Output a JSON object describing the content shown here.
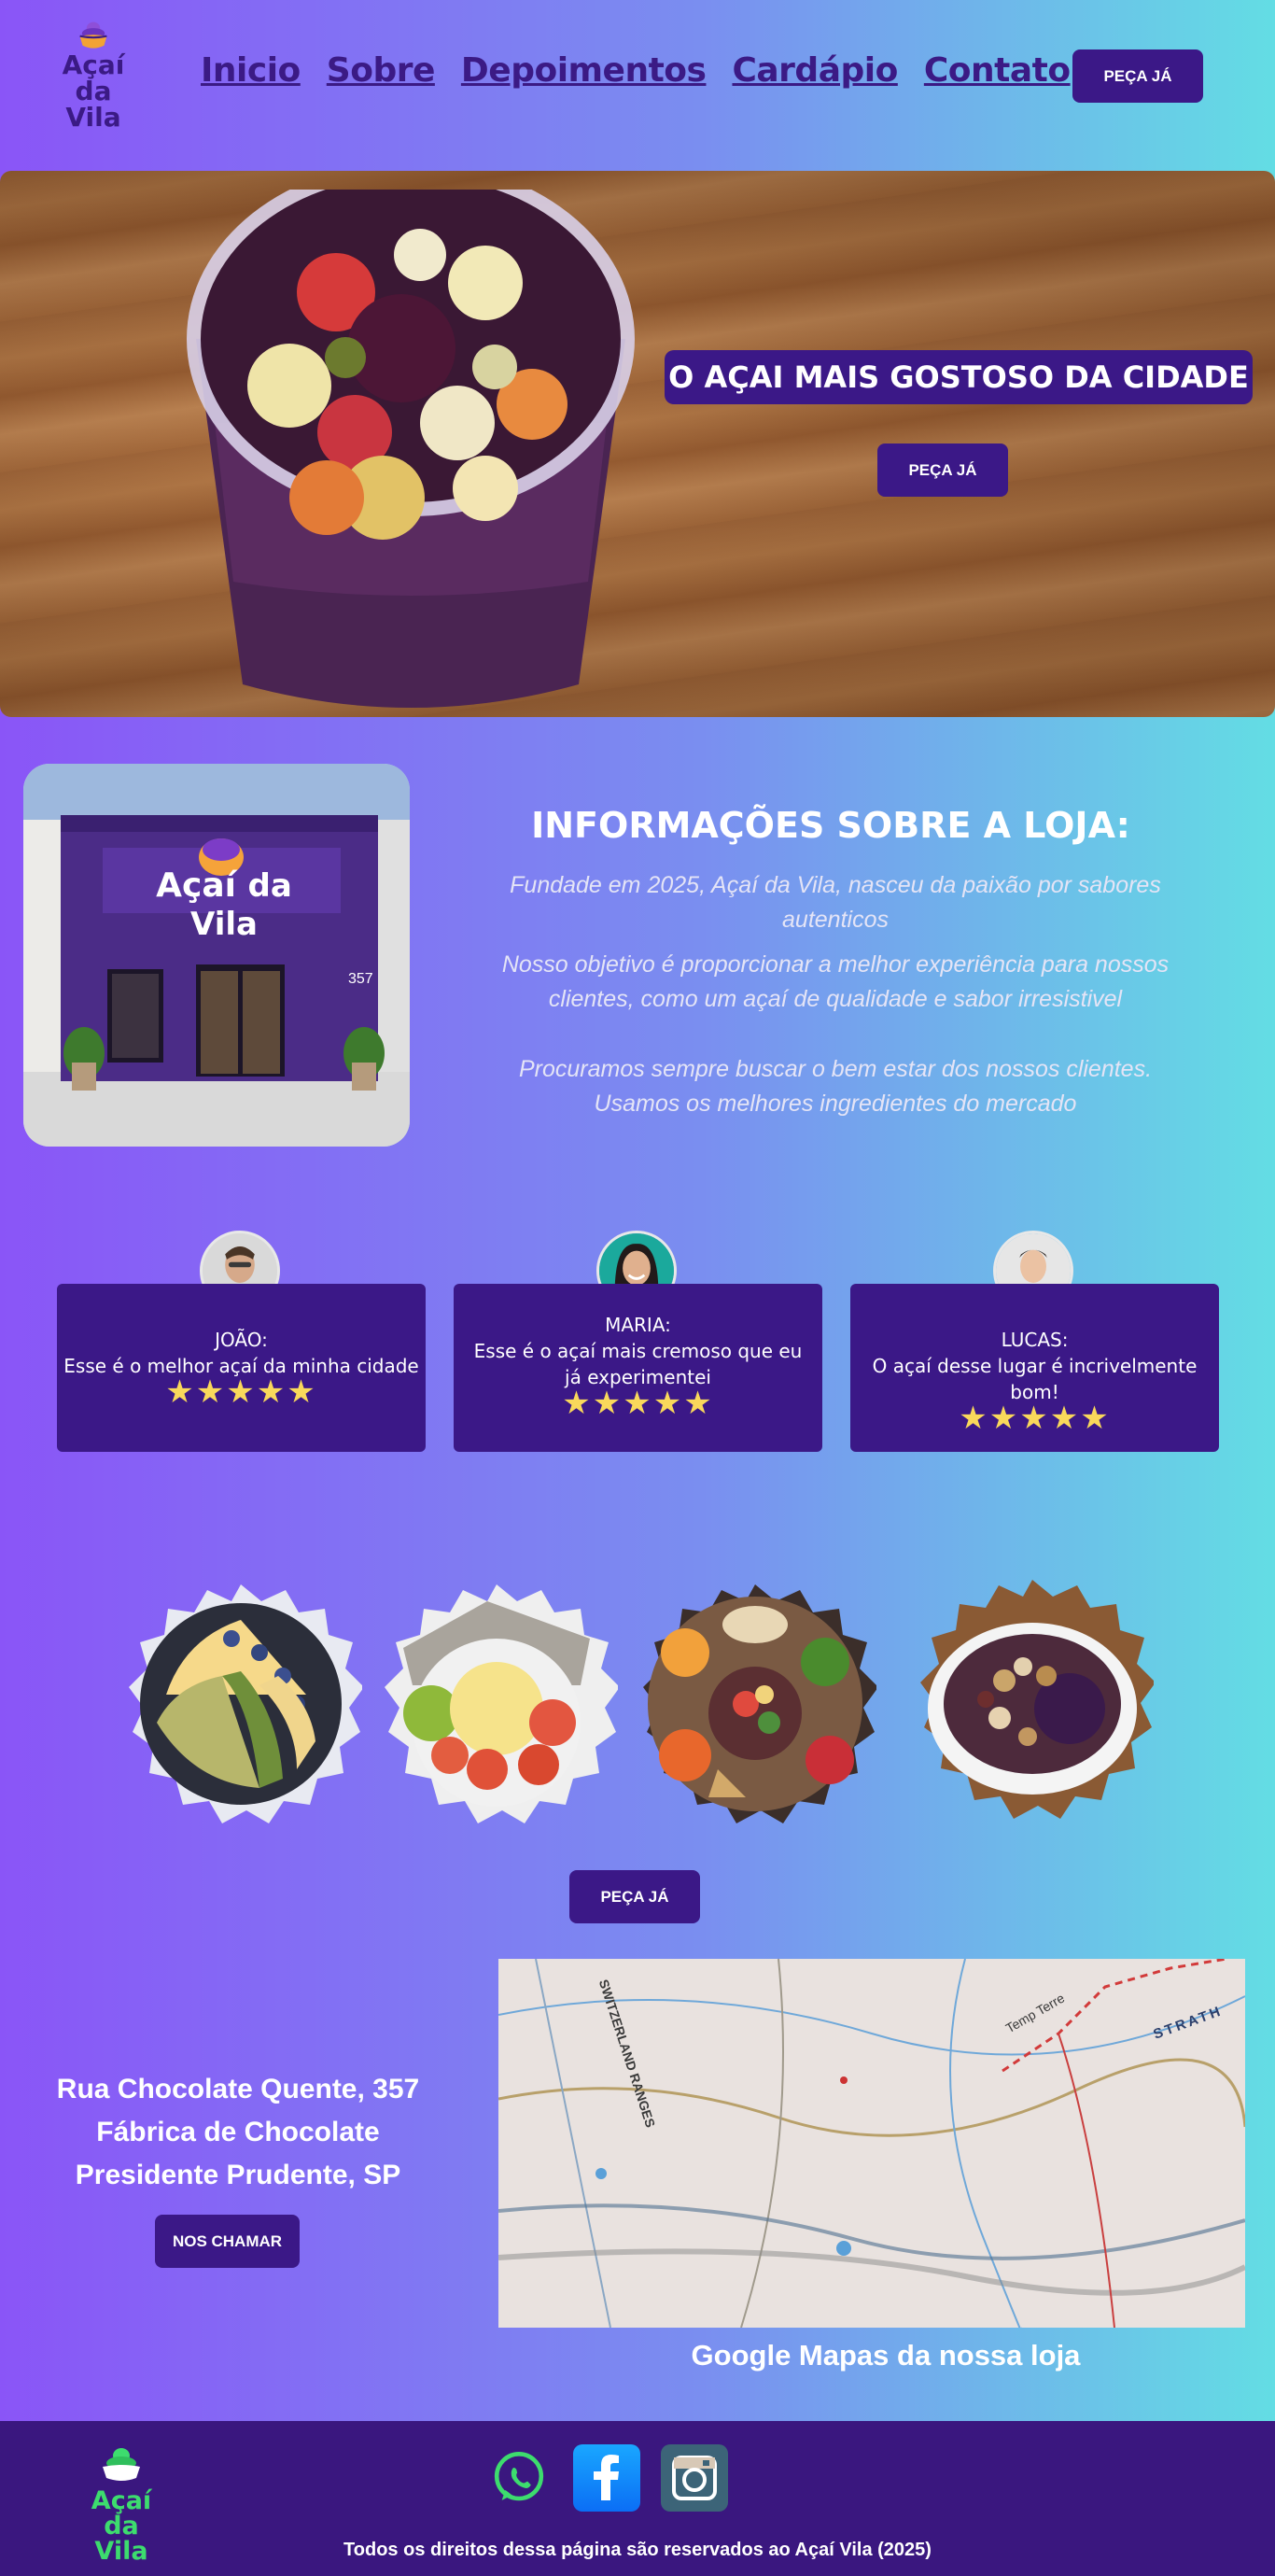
{
  "nav": {
    "logo_line1": "Açaí",
    "logo_line2": "da Vila",
    "links": [
      "Inicio",
      "Sobre",
      "Depoimentos",
      "Cardápio",
      "Contato"
    ],
    "cta": "PEÇA JÁ"
  },
  "hero": {
    "title": "O AÇAI MAIS GOSTOSO DA CIDADE",
    "cta": "PEÇA JÁ"
  },
  "store": {
    "sign_part1": "Açaí",
    "sign_part2": "da Vila",
    "number": "357"
  },
  "info": {
    "title": "INFORMAÇÕES SOBRE A LOJA:",
    "p1": "Fundade em 2025, Açaí da Vila, nasceu da paixão  por sabores autenticos",
    "p2": "Nosso objetivo é proporcionar a melhor experiência para nossos clientes, como um açaí de qualidade e sabor irresistivel",
    "p3": "Procuramos sempre buscar o bem estar dos nossos clientes. Usamos os melhores ingredientes do mercado"
  },
  "testimonials": [
    {
      "name": "JOÃO:",
      "text": "Esse é o melhor açaí da minha cidade",
      "stars": "★★★★★",
      "rating": 5
    },
    {
      "name": "MARIA:",
      "text": "Esse é o açaí mais cremoso que eu já experimentei",
      "stars": "★★★★★",
      "rating": 5
    },
    {
      "name": "LUCAS:",
      "text": "O açaí desse lugar é incrivelmente bom!",
      "stars": "★★★★★",
      "rating": 5
    }
  ],
  "menu_cta": "PEÇA JÁ",
  "contact": {
    "line1": "Rua Chocolate Quente, 357",
    "line2": "Fábrica de Chocolate",
    "line3": "Presidente Prudente, SP",
    "cta": "NOS CHAMAR",
    "map_caption": "Google Mapas da nossa loja",
    "map_labels": [
      "SWITZERLAND RANGES",
      "Temp Terre",
      "STRATH"
    ]
  },
  "footer": {
    "logo_line1": "Açaí",
    "logo_line2": "da Vila",
    "copyright": "Todos os direitos dessa página são reservados ao Açaí Vila (2025)"
  },
  "colors": {
    "primary": "#3b1887",
    "gradient_left": "#8a55f7",
    "gradient_right": "#63dde4",
    "star": "#f9d85b",
    "footer_logo": "#3ddc6e"
  }
}
